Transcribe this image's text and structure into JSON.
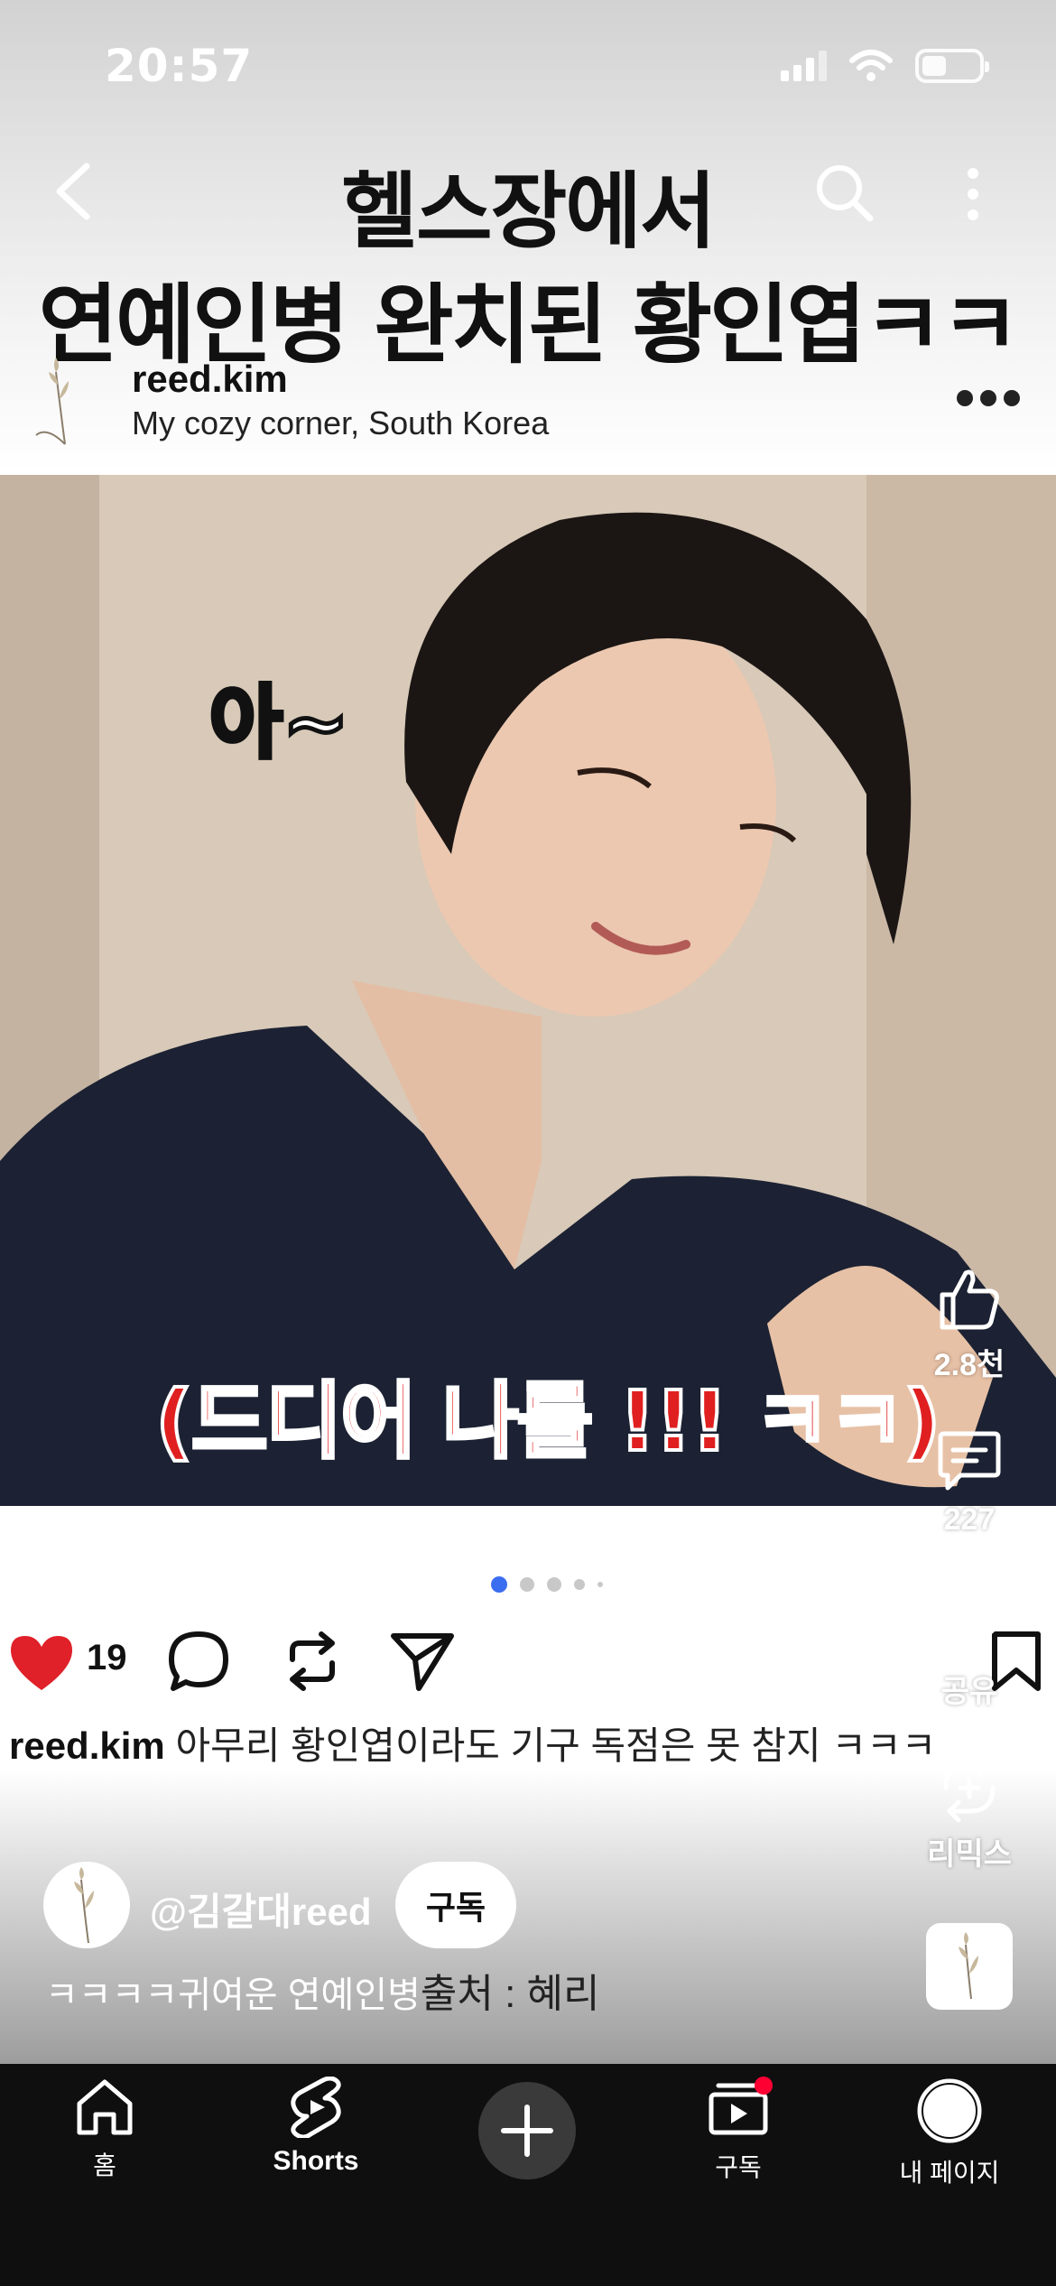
{
  "status": {
    "time": "20:57"
  },
  "header": {
    "title_line1": "헬스장에서",
    "title_line2": "연예인병 완치된 황인엽ㅋㅋ"
  },
  "post": {
    "username": "reed.kim",
    "location": "My cozy corner, South Korea",
    "photo_caption_top": "아~",
    "photo_caption_bottom": "(드디어 나를 !!! ㅋㅋ)",
    "likes": "19",
    "caption_user": "reed.kim",
    "caption_text": "아무리 황인엽이라도 기구 독점은 못 참지 ㅋㅋㅋ",
    "carousel": {
      "count": 5,
      "active": 0
    }
  },
  "side_actions": {
    "like_count": "2.8천",
    "comment_count": "227",
    "share_label": "공유",
    "remix_label": "리믹스"
  },
  "channel": {
    "handle": "@김갈대reed",
    "subscribe_label": "구독",
    "description": "ㅋㅋㅋㅋ귀여운 연예인병",
    "source_text": "출처 : 혜리"
  },
  "nav": {
    "home": "홈",
    "shorts": "Shorts",
    "subscriptions": "구독",
    "my_page": "내 페이지"
  },
  "colors": {
    "heart": "#e0212a",
    "active_dot": "#3b6df0",
    "notification_dot": "#ff0033",
    "navbar_bg": "#0f0f0f"
  }
}
